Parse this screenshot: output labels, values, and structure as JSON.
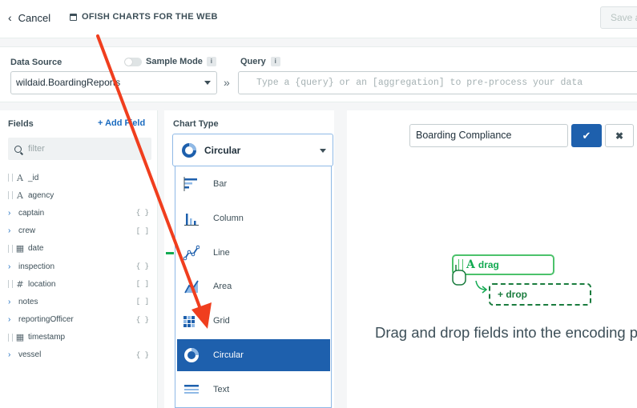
{
  "header": {
    "cancel_label": "Cancel",
    "doc_title": "OFISH CHARTS FOR THE WEB",
    "save_label": "Save a"
  },
  "datasource": {
    "label": "Data Source",
    "value": "wildaid.BoardingReports",
    "sample_mode_label": "Sample Mode",
    "query_label": "Query",
    "query_placeholder": "Type a {query} or an [aggregation] to pre-process your data"
  },
  "fields": {
    "title": "Fields",
    "add_label": "+ Add Field",
    "filter_placeholder": "filter",
    "items": [
      {
        "name": "_id",
        "kind": "string",
        "type_badge": ""
      },
      {
        "name": "agency",
        "kind": "string",
        "type_badge": ""
      },
      {
        "name": "captain",
        "kind": "object",
        "type_badge": "{ }"
      },
      {
        "name": "crew",
        "kind": "array",
        "type_badge": "[ ]"
      },
      {
        "name": "date",
        "kind": "date",
        "type_badge": ""
      },
      {
        "name": "inspection",
        "kind": "object",
        "type_badge": "{ }"
      },
      {
        "name": "location",
        "kind": "number",
        "type_badge": "[ ]"
      },
      {
        "name": "notes",
        "kind": "array",
        "type_badge": "[ ]"
      },
      {
        "name": "reportingOfficer",
        "kind": "object",
        "type_badge": "{ }"
      },
      {
        "name": "timestamp",
        "kind": "date",
        "type_badge": ""
      },
      {
        "name": "vessel",
        "kind": "object",
        "type_badge": "{ }"
      }
    ]
  },
  "chart_type": {
    "title": "Chart Type",
    "selected": "Circular",
    "options": [
      {
        "label": "Bar",
        "icon": "bar-chart-icon"
      },
      {
        "label": "Column",
        "icon": "column-chart-icon"
      },
      {
        "label": "Line",
        "icon": "line-chart-icon"
      },
      {
        "label": "Area",
        "icon": "area-chart-icon"
      },
      {
        "label": "Grid",
        "icon": "grid-chart-icon"
      },
      {
        "label": "Circular",
        "icon": "circular-chart-icon"
      },
      {
        "label": "Text",
        "icon": "text-chart-icon"
      }
    ]
  },
  "canvas": {
    "title_value": "Boarding Compliance",
    "drag_label": "drag",
    "drop_label": "+ drop",
    "hint": "Drag and drop fields into the encoding p"
  },
  "colors": {
    "accent": "#1e60ad",
    "green": "#13aa52",
    "annotation_arrow": "#f03e1e"
  }
}
